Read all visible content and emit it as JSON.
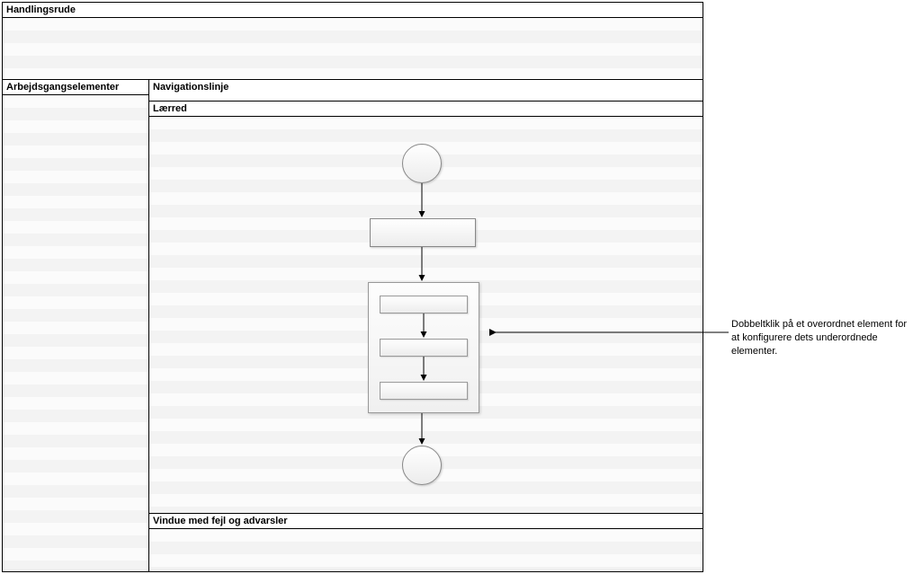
{
  "panes": {
    "action_pane_title": "Handlingsrude",
    "sidebar_title": "Arbejdsgangselementer",
    "navigation_title": "Navigationslinje",
    "canvas_title": "Lærred",
    "errors_title": "Vindue med fejl og advarsler"
  },
  "annotation": {
    "text": "Dobbeltklik på et overordnet element for at konfigurere dets underordnede elementer."
  },
  "flow": {
    "nodes": [
      {
        "id": "start",
        "type": "circle"
      },
      {
        "id": "step1",
        "type": "rect"
      },
      {
        "id": "container",
        "type": "container",
        "children": [
          "sub1",
          "sub2",
          "sub3"
        ]
      },
      {
        "id": "end",
        "type": "circle"
      }
    ],
    "edges": [
      [
        "start",
        "step1"
      ],
      [
        "step1",
        "container"
      ],
      [
        "container",
        "end"
      ],
      [
        "sub1",
        "sub2"
      ],
      [
        "sub2",
        "sub3"
      ]
    ]
  }
}
